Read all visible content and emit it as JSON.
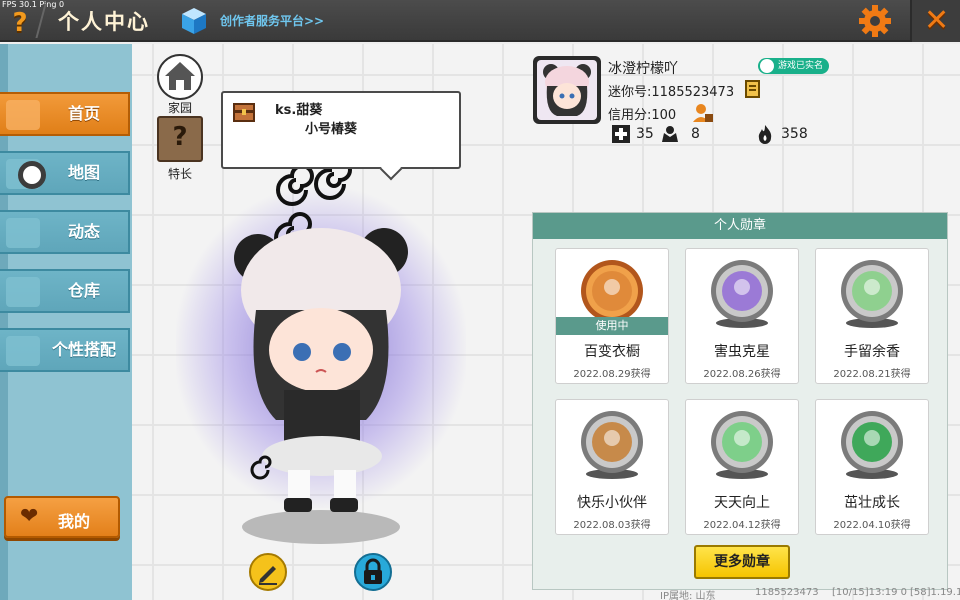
{
  "debug": {
    "fps_text": "FPS 30.1  Ping 0"
  },
  "header": {
    "title": "个人中心",
    "creator_link": "创作者服务平台>>"
  },
  "icons": {
    "help": "question-icon",
    "settings": "gear-icon",
    "close": "close-icon"
  },
  "sidebar": {
    "items": [
      {
        "label": "首页",
        "icon": "home-icon",
        "active": true
      },
      {
        "label": "地图",
        "icon": "map-icon",
        "active": false
      },
      {
        "label": "动态",
        "icon": "bell-icon",
        "active": false
      },
      {
        "label": "仓库",
        "icon": "warehouse-icon",
        "active": false
      },
      {
        "label": "个性搭配",
        "icon": "outfit-icon",
        "active": false
      }
    ],
    "mine_label": "我的"
  },
  "quick": {
    "home_label": "家园",
    "skill_label": "特长"
  },
  "speech": {
    "name": "ks.甜葵",
    "sub": "小号椿葵"
  },
  "profile": {
    "username": "冰澄柠檬吖",
    "realname_badge": "游戏已实名",
    "uid": "迷你号:1185523473",
    "credit": "信用分:100",
    "stats": {
      "plus": "35",
      "fans": "8",
      "fire": "358"
    }
  },
  "badges": {
    "title": "个人勋章",
    "in_use_label": "使用中",
    "items": [
      {
        "name": "百变衣橱",
        "date": "2022.08.29获得",
        "in_use": true,
        "color": "#e08a3a"
      },
      {
        "name": "害虫克星",
        "date": "2022.08.26获得",
        "in_use": false,
        "color": "#9b7ad6"
      },
      {
        "name": "手留余香",
        "date": "2022.08.21获得",
        "in_use": false,
        "color": "#8fd08f"
      },
      {
        "name": "快乐小伙伴",
        "date": "2022.08.03获得",
        "in_use": false,
        "color": "#c78a4a"
      },
      {
        "name": "天天向上",
        "date": "2022.04.12获得",
        "in_use": false,
        "color": "#7ecf8a"
      },
      {
        "name": "茁壮成长",
        "date": "2022.04.10获得",
        "in_use": false,
        "color": "#3fa85a"
      }
    ],
    "more_label": "更多勋章"
  },
  "footer": {
    "ip": "IP属地: 山东",
    "uid": "1185523473",
    "time": "[10/15]13:19 0",
    "version": "[58]1.19.1"
  },
  "colors": {
    "accent_orange": "#e8861f",
    "sidebar_teal": "#6eb4c7",
    "badge_header": "#5a9a8c"
  }
}
